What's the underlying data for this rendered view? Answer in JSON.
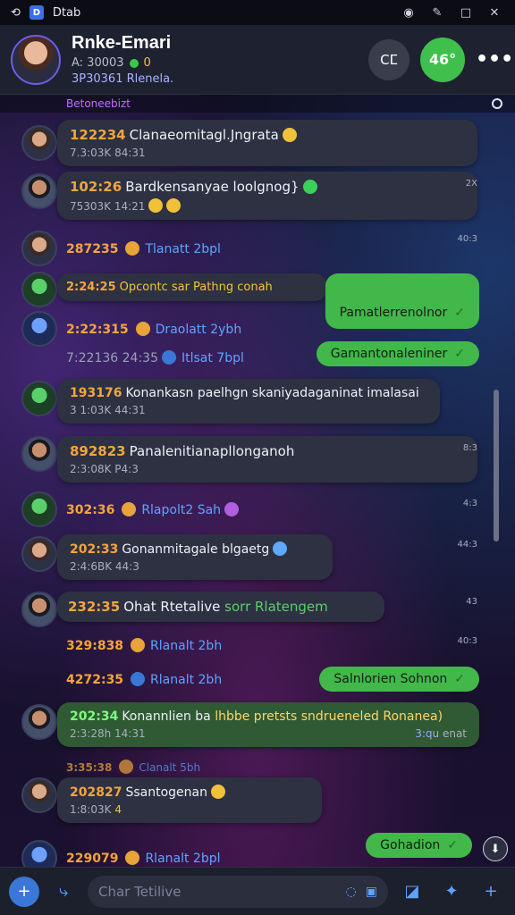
{
  "os": {
    "title": "Dtab",
    "minimize": "_",
    "maximize": "□",
    "close": "✕"
  },
  "header": {
    "name": "Rnke-Emari",
    "status_line": "A: 30003",
    "online_count": "0",
    "sub_line": "3P30361 Rlenela.",
    "call_label": "Cⵎ",
    "video_label": "46°",
    "more_label": "•••"
  },
  "pinned": {
    "label": "Betoneebizt"
  },
  "messages": [
    {
      "num": "122234",
      "text": "Clanaeomitagl.Jngrata",
      "meta": "7.3:03K 84:31",
      "stamp": ""
    },
    {
      "num": "102:26",
      "text": "Bardkensanyae loolgnog}",
      "meta": "75303K 14:21",
      "stamp": "2X"
    },
    {
      "num": "287235",
      "label": "Tlanatt 2bpl",
      "stamp": "40:3"
    },
    {
      "num": "2:24:25",
      "text": "Opcontc sar Pathng conah",
      "meta": "",
      "stamp": ""
    },
    {
      "num": "2:22:315",
      "label": "Draolatt 2ybh",
      "stamp": ""
    },
    {
      "num": "7:22136",
      "meta2": "24:35",
      "label": "Itlsat 7bpl",
      "stamp": ""
    },
    {
      "num": "193176",
      "text": "Konankasn paelhgn skaniyadaganinat imalasai",
      "meta": "3 1:03K 44:31",
      "stamp": ""
    },
    {
      "num": "892823",
      "text": "Panalenitianapllonganoh",
      "meta": "2:3:08K P4:3",
      "stamp": "8:3"
    },
    {
      "num": "302:36",
      "label": "Rlapolt2 Sah",
      "stamp": "4:3"
    },
    {
      "num": "202:33",
      "text": "Gonanmitagale blgaetg",
      "meta": "2:4:6BK 44:3",
      "stamp": "44:3"
    },
    {
      "num": "232:35",
      "text": "Ohat Rtetalive",
      "green_text": "sorr Rlatengem",
      "meta": "",
      "stamp": "43"
    },
    {
      "num": "329:838",
      "label": "Rlanalt 2bh",
      "stamp": "40:3"
    },
    {
      "num": "4272:35",
      "label": "Rlanalt 2bh",
      "stamp": ""
    },
    {
      "num": "202:34",
      "text": "Konannlien ba",
      "green_text": "lhbbe pretsts sndrueneled Ronanea)",
      "meta": "2:3:28h 14:31",
      "tail": "3:qu",
      "tail2": "enat",
      "stamp": ""
    },
    {
      "num": "3:35:38",
      "label": "Clanalt 5bh",
      "stamp": ""
    },
    {
      "num": "202827",
      "text": "Ssantogenan",
      "meta": "1:8:03K",
      "tail": "4",
      "stamp": ""
    },
    {
      "num": "229079",
      "label": "Rlanalt 2bpl",
      "stamp": ""
    }
  ],
  "outgoing": [
    {
      "text": "Pamatlerrenolnor",
      "tick": "✓"
    },
    {
      "text": "Gamantonaleniner",
      "tick": "✓"
    },
    {
      "text": "Salnlorien Sohnon",
      "tick": "✓"
    },
    {
      "text": "Gohadion",
      "tick": "✓"
    }
  ],
  "composer": {
    "placeholder": "Char Tetilive"
  },
  "colors": {
    "accent": "#42b84a",
    "link": "#5ea4ff",
    "number": "#f4a53c",
    "bubble": "#2d3142"
  }
}
